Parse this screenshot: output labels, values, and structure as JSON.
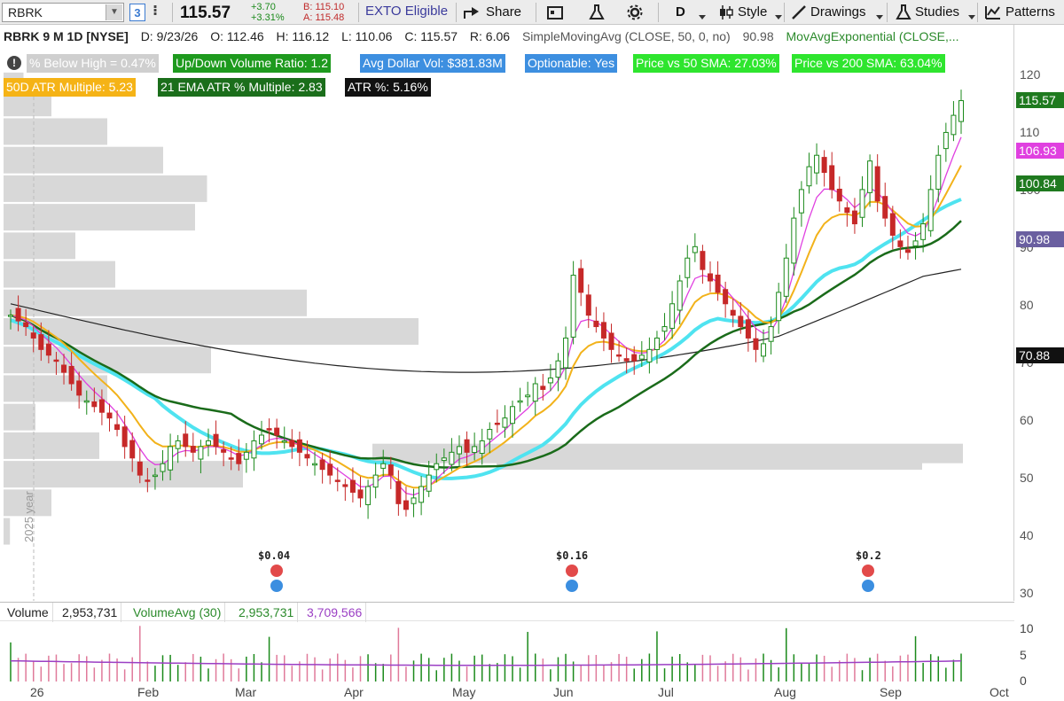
{
  "toolbar": {
    "symbol": "RBRK",
    "link_badge": "3",
    "more": "⁝",
    "last": "115.57",
    "change": "+3.70",
    "change_pct": "+3.31%",
    "bid": "B: 115.10",
    "ask": "A: 115.48",
    "exto": "EXTO Eligible",
    "share": "Share",
    "period": "D",
    "style": "Style",
    "drawings": "Drawings",
    "studies": "Studies",
    "patterns": "Patterns"
  },
  "info": {
    "title": "RBRK 9 M 1D [NYSE]",
    "date": "D: 9/23/26",
    "open": "O: 112.46",
    "high": "H: 116.12",
    "low": "L: 110.06",
    "close": "C: 115.57",
    "range": "R: 6.06",
    "sma": "SimpleMovingAvg (CLOSE, 50, 0, no)",
    "sma_value": "90.98",
    "ema": "MovAvgExponential (CLOSE,..."
  },
  "chips": {
    "alert": "!",
    "below_high": "% Below High = 0.47%",
    "updown": "Up/Down Volume Ratio: 1.2",
    "dollar_vol": "Avg Dollar Vol: $381.83M",
    "optionable": "Optionable: Yes",
    "vs50": "Price vs 50 SMA: 27.03%",
    "vs200": "Price vs 200 SMA: 63.04%",
    "atr50": "50D ATR Multiple: 5.23",
    "ema21atr": "21 EMA ATR % Multiple: 2.83",
    "atrpct": "ATR %: 5.16%"
  },
  "price_axis": {
    "ticks": [
      "120",
      "110",
      "100",
      "90",
      "80",
      "70",
      "60",
      "50",
      "40",
      "30"
    ],
    "tags": [
      {
        "label": "115.57",
        "color": "#1f7a1f"
      },
      {
        "label": "106.93",
        "color": "#e040e0"
      },
      {
        "label": "100.84",
        "color": "#1f7a1f"
      },
      {
        "label": "90.98",
        "color": "#6a5fa0"
      },
      {
        "label": "70.88",
        "color": "#111111"
      }
    ]
  },
  "dividends": [
    "$0.04",
    "$0.16",
    "$0.2"
  ],
  "year_label": "2025 year",
  "volume": {
    "title": "Volume",
    "value": "2,953,731",
    "avg_label": "VolumeAvg (30)",
    "avg_value": "2,953,731",
    "avg2": "3,709,566",
    "axis": [
      "10",
      "5",
      "0"
    ]
  },
  "time_axis": [
    "26",
    "Feb",
    "Mar",
    "Apr",
    "May",
    "Jun",
    "Jul",
    "Aug",
    "Sep",
    "Oct"
  ],
  "colors": {
    "up": "#1b8a1b",
    "down": "#c62828",
    "sma50": "#1a6b1a",
    "sma200": "#222222",
    "ema10": "#e040e0",
    "ema21": "#f2b21a",
    "cyan": "#4fe3f0"
  },
  "chart_data": {
    "type": "candlestick",
    "symbol": "RBRK",
    "timeframe": "9 M 1D",
    "ylim": [
      30,
      125
    ],
    "last_bar": {
      "date": "9/23/26",
      "open": 112.46,
      "high": 116.12,
      "low": 110.06,
      "close": 115.57
    },
    "closes_approx": [
      78,
      77,
      76,
      74,
      72,
      71,
      70,
      68,
      66,
      64,
      63,
      62,
      61,
      60,
      58,
      55,
      53,
      50,
      49,
      50,
      52,
      55,
      56,
      55,
      54,
      55,
      56,
      55,
      54,
      53,
      52,
      54,
      56,
      57,
      58,
      57,
      56,
      55,
      54,
      53,
      52,
      51,
      50,
      49,
      48,
      47,
      46,
      48,
      50,
      52,
      50,
      45,
      44,
      46,
      48,
      50,
      52,
      53,
      54,
      55,
      54,
      55,
      56,
      58,
      59,
      60,
      62,
      63,
      64,
      66,
      65,
      67,
      70,
      74,
      85,
      82,
      78,
      76,
      74,
      72,
      71,
      70,
      70,
      71,
      72,
      74,
      76,
      80,
      84,
      88,
      90,
      86,
      84,
      82,
      80,
      78,
      76,
      74,
      72,
      73,
      76,
      82,
      88,
      95,
      100,
      104,
      106,
      103,
      100,
      98,
      96,
      94,
      100,
      105,
      98,
      95,
      92,
      90,
      89,
      91,
      94,
      100,
      106,
      110,
      113,
      115.57
    ],
    "series": [
      {
        "name": "SimpleMovingAvg (CLOSE, 50, 0, no)",
        "last": 90.98
      },
      {
        "name": "MovAvgExponential (CLOSE,...",
        "last": 100.84
      }
    ]
  }
}
